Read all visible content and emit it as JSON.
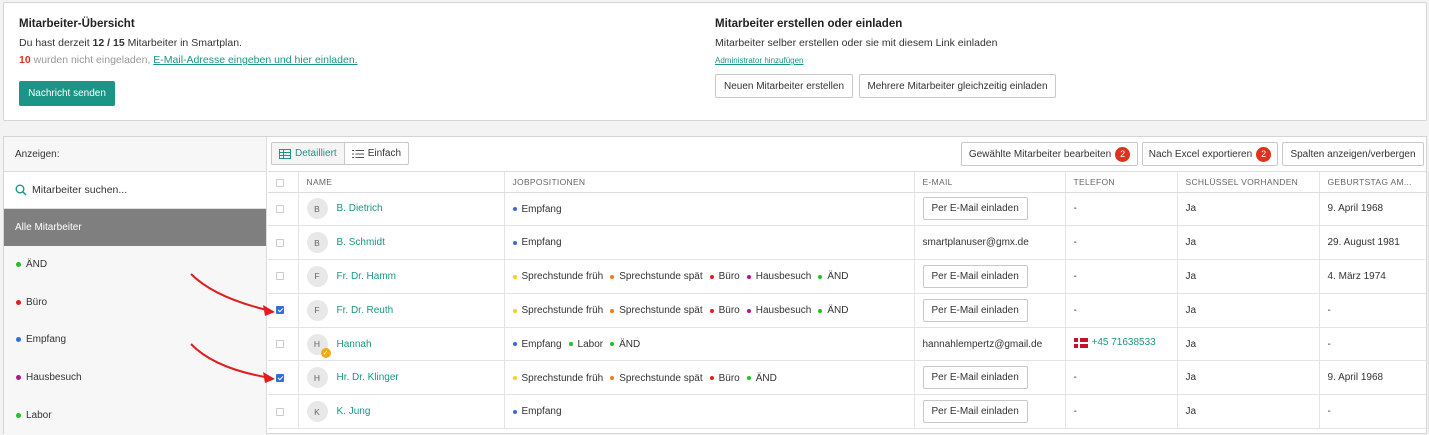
{
  "overview": {
    "title": "Mitarbeiter-Übersicht",
    "line1_pre": "Du hast derzeit ",
    "line1_count": "12 / 15",
    "line1_post": " Mitarbeiter in Smartplan.",
    "line2_count": "10",
    "line2_text": " wurden nicht eingeladen, ",
    "line2_link": "E-Mail-Adresse eingeben und hier einladen.",
    "send_button": "Nachricht senden"
  },
  "create": {
    "title": "Mitarbeiter erstellen oder einladen",
    "subtitle": "Mitarbeiter selber erstellen oder sie mit diesem Link einladen",
    "admin_link": "Administrator hinzufügen",
    "new_button": "Neuen Mitarbeiter erstellen",
    "multi_button": "Mehrere Mitarbeiter gleichzeitig einladen"
  },
  "sidebar": {
    "heading": "Anzeigen:",
    "search_placeholder": "Mitarbeiter suchen...",
    "all_label": "Alle Mitarbeiter",
    "items": [
      {
        "label": "ÄND",
        "color": "#22c122"
      },
      {
        "label": "Büro",
        "color": "#e01e1e"
      },
      {
        "label": "Empfang",
        "color": "#2f6fd8"
      },
      {
        "label": "Hausbesuch",
        "color": "#b0168a"
      },
      {
        "label": "Labor",
        "color": "#22c122"
      }
    ]
  },
  "toolbar": {
    "view_detailed": "Detailliert",
    "view_simple": "Einfach",
    "edit_selected": "Gewählte Mitarbeiter bearbeiten",
    "edit_badge": "2",
    "export_excel": "Nach Excel exportieren",
    "export_badge": "2",
    "toggle_columns": "Spalten anzeigen/verbergen"
  },
  "table": {
    "headers": [
      "NAME",
      "JOBPOSITIONEN",
      "E-MAIL",
      "TELEFON",
      "SCHLÜSSEL VORHANDEN",
      "GEBURTSTAG AM..."
    ],
    "invite_label": "Per E-Mail einladen",
    "job_colors": {
      "Empfang": "#2f6fd8",
      "Sprechstunde früh": "#f2d21b",
      "Sprechstunde spät": "#f07b17",
      "Büro": "#e01e1e",
      "Hausbesuch": "#b0168a",
      "ÄND": "#22c122",
      "Labor": "#22c122"
    },
    "rows": [
      {
        "initial": "B",
        "name": "B. Dietrich",
        "jobs": [
          "Empfang"
        ],
        "email": "",
        "invite": true,
        "phone": "-",
        "flag": false,
        "key": "Ja",
        "birthday": "9. April 1968",
        "checked": false,
        "badge": false
      },
      {
        "initial": "B",
        "name": "B. Schmidt",
        "jobs": [
          "Empfang"
        ],
        "email": "smartplanuser@gmx.de",
        "invite": false,
        "phone": "-",
        "flag": false,
        "key": "Ja",
        "birthday": "29. August 1981",
        "checked": false,
        "badge": false
      },
      {
        "initial": "F",
        "name": "Fr. Dr. Hamm",
        "jobs": [
          "Sprechstunde früh",
          "Sprechstunde spät",
          "Büro",
          "Hausbesuch",
          "ÄND"
        ],
        "email": "",
        "invite": true,
        "phone": "-",
        "flag": false,
        "key": "Ja",
        "birthday": "4. März 1974",
        "checked": false,
        "badge": false
      },
      {
        "initial": "F",
        "name": "Fr. Dr. Reuth",
        "jobs": [
          "Sprechstunde früh",
          "Sprechstunde spät",
          "Büro",
          "Hausbesuch",
          "ÄND"
        ],
        "email": "",
        "invite": true,
        "phone": "-",
        "flag": false,
        "key": "Ja",
        "birthday": "-",
        "checked": true,
        "badge": false
      },
      {
        "initial": "H",
        "name": "Hannah",
        "jobs": [
          "Empfang",
          "Labor",
          "ÄND"
        ],
        "email": "hannahlempertz@gmail.de",
        "invite": false,
        "phone": "+45 71638533",
        "flag": true,
        "key": "Ja",
        "birthday": "-",
        "checked": false,
        "badge": true
      },
      {
        "initial": "H",
        "name": "Hr. Dr. Klinger",
        "jobs": [
          "Sprechstunde früh",
          "Sprechstunde spät",
          "Büro",
          "ÄND"
        ],
        "email": "",
        "invite": true,
        "phone": "-",
        "flag": false,
        "key": "Ja",
        "birthday": "9. April 1968",
        "checked": true,
        "badge": false
      },
      {
        "initial": "K",
        "name": "K. Jung",
        "jobs": [
          "Empfang"
        ],
        "email": "",
        "invite": true,
        "phone": "-",
        "flag": false,
        "key": "Ja",
        "birthday": "-",
        "checked": false,
        "badge": false
      }
    ]
  }
}
